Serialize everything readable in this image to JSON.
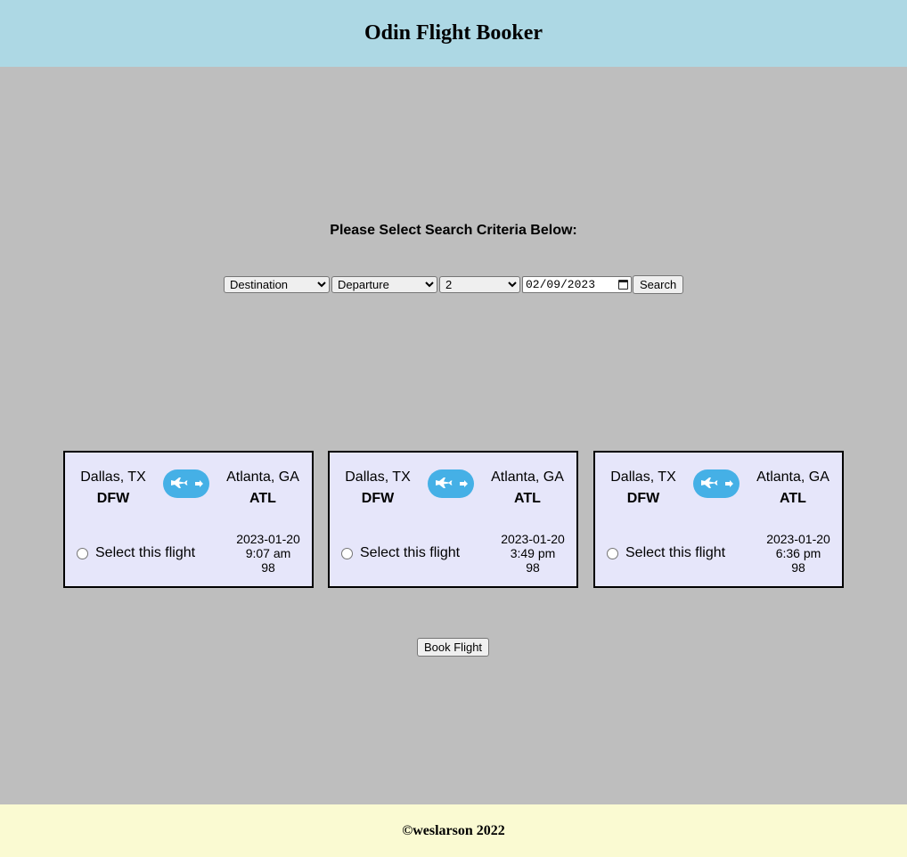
{
  "header": {
    "title": "Odin Flight Booker"
  },
  "search": {
    "heading": "Please Select Search Criteria Below:",
    "destination_selected": "Destination",
    "departure_selected": "Departure",
    "passengers_selected": "2",
    "date_value": "02/09/2023",
    "search_label": "Search"
  },
  "flights": [
    {
      "from_city": "Dallas, TX",
      "from_code": "DFW",
      "to_city": "Atlanta, GA",
      "to_code": "ATL",
      "select_label": "Select this flight",
      "date": "2023-01-20",
      "time": "9:07 am",
      "duration": "98"
    },
    {
      "from_city": "Dallas, TX",
      "from_code": "DFW",
      "to_city": "Atlanta, GA",
      "to_code": "ATL",
      "select_label": "Select this flight",
      "date": "2023-01-20",
      "time": "3:49 pm",
      "duration": "98"
    },
    {
      "from_city": "Dallas, TX",
      "from_code": "DFW",
      "to_city": "Atlanta, GA",
      "to_code": "ATL",
      "select_label": "Select this flight",
      "date": "2023-01-20",
      "time": "6:36 pm",
      "duration": "98"
    }
  ],
  "book_label": "Book Flight",
  "footer": {
    "text": "©weslarson 2022"
  },
  "icons": {
    "flight_badge": "airplane-arrow-icon",
    "date_picker": "calendar-icon"
  },
  "colors": {
    "header_bg": "#add8e4",
    "page_bg": "#bebebe",
    "card_bg": "#e6e6fa",
    "footer_bg": "#fafad2",
    "badge_blue": "#45b0e6"
  }
}
